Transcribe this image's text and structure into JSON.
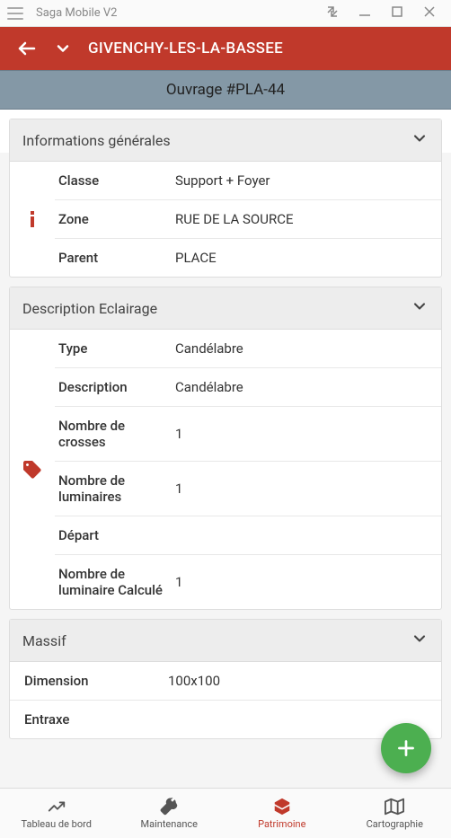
{
  "window": {
    "title": "Saga Mobile V2"
  },
  "header": {
    "title": "GIVENCHY-LES-LA-BASSEE"
  },
  "subheader": {
    "title": "Ouvrage #PLA-44"
  },
  "sections": {
    "info": {
      "title": "Informations générales",
      "rows": {
        "classe": {
          "label": "Classe",
          "value": "Support + Foyer"
        },
        "zone": {
          "label": "Zone",
          "value": "RUE DE LA SOURCE"
        },
        "parent": {
          "label": "Parent",
          "value": "PLACE"
        }
      }
    },
    "desc": {
      "title": "Description Eclairage",
      "rows": {
        "type": {
          "label": "Type",
          "value": "Candélabre"
        },
        "description": {
          "label": "Description",
          "value": "Candélabre"
        },
        "crosses": {
          "label": "Nombre de crosses",
          "value": "1"
        },
        "luminaires": {
          "label": "Nombre de luminaires",
          "value": "1"
        },
        "depart": {
          "label": "Départ",
          "value": ""
        },
        "lumcalc": {
          "label": "Nombre de luminaire Calculé",
          "value": "1"
        }
      }
    },
    "massif": {
      "title": "Massif",
      "rows": {
        "dimension": {
          "label": "Dimension",
          "value": "100x100"
        },
        "entraxe": {
          "label": "Entraxe",
          "value": ""
        }
      }
    }
  },
  "bottomnav": {
    "dashboard": "Tableau de bord",
    "maintenance": "Maintenance",
    "patrimoine": "Patrimoine",
    "cartographie": "Cartographie"
  }
}
